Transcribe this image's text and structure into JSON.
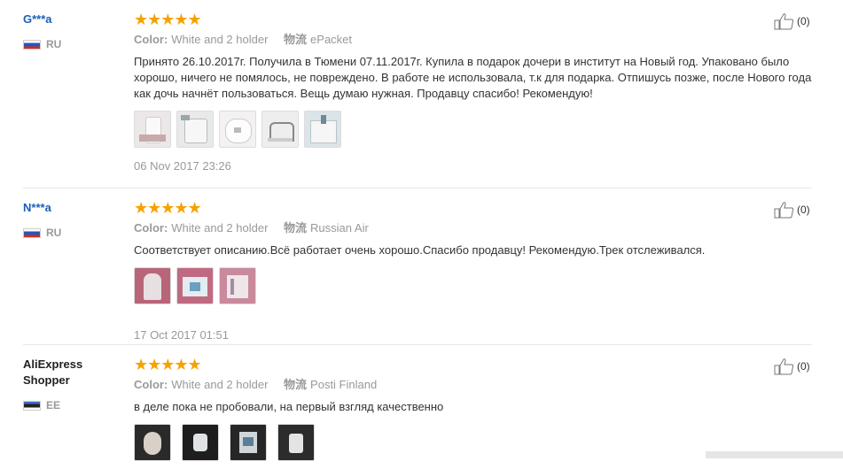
{
  "field_labels": {
    "color": "Color:",
    "shipping": "物流"
  },
  "reviews": [
    {
      "user": "G***a",
      "country": "RU",
      "stars": "★★★★★",
      "color_value": "White and 2 holder",
      "shipping_value": "ePacket",
      "text": "Принято 26.10.2017г. Получила в Тюмени 07.11.2017г. Купила в подарок дочери в институт на Новый год. Упаковано было хорошо, ничего не помялось, не повреждено. В работе не использовала, т.к для подарка. Отпишусь позже, после Нового года как дочь начнёт пользоваться. Вещь думаю нужная. Продавцу спасибо! Рекомендую!",
      "date": "06 Nov 2017 23:26",
      "likes": "(0)"
    },
    {
      "user": "N***a",
      "country": "RU",
      "stars": "★★★★★",
      "color_value": "White and 2 holder",
      "shipping_value": "Russian Air",
      "text": "Соответствует описанию.Всё работает очень хорошо.Спасибо продавцу! Рекомендую.Трек отслеживался.",
      "date": "17 Oct 2017 01:51",
      "likes": "(0)"
    },
    {
      "user_line1": "AliExpress",
      "user_line2": "Shopper",
      "country": "EE",
      "stars": "★★★★★",
      "color_value": "White and 2 holder",
      "shipping_value": "Posti Finland",
      "text": "в деле пока не пробовали, на первый взгляд качественно",
      "likes": "(0)"
    }
  ]
}
